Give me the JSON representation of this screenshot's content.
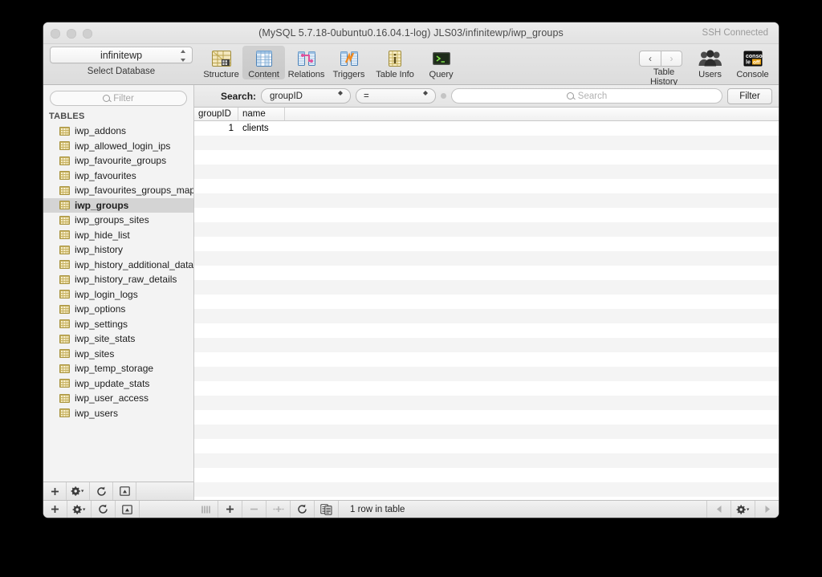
{
  "window": {
    "title": "(MySQL 5.7.18-0ubuntu0.16.04.1-log) JLS03/infinitewp/iwp_groups",
    "connection_status": "SSH Connected",
    "traffic_lights": [
      "close-button",
      "minimize-button",
      "zoom-button"
    ]
  },
  "toolbar": {
    "database_selected": "infinitewp",
    "database_label": "Select Database",
    "items": [
      {
        "label": "Structure",
        "icon": "structure-icon",
        "selected": false
      },
      {
        "label": "Content",
        "icon": "content-icon",
        "selected": true
      },
      {
        "label": "Relations",
        "icon": "relations-icon",
        "selected": false
      },
      {
        "label": "Triggers",
        "icon": "triggers-icon",
        "selected": false
      },
      {
        "label": "Table Info",
        "icon": "table-info-icon",
        "selected": false
      },
      {
        "label": "Query",
        "icon": "query-icon",
        "selected": false
      }
    ],
    "right_items": [
      {
        "label": "Table History",
        "icon": "history-nav-arrows"
      },
      {
        "label": "Users",
        "icon": "users-icon"
      },
      {
        "label": "Console",
        "icon": "console-icon"
      }
    ],
    "console_icon_text": {
      "line1": "conso",
      "line2": "le",
      "badge": "off"
    }
  },
  "sidebar": {
    "filter_placeholder": "Filter",
    "section_header": "TABLES",
    "tables": [
      {
        "name": "iwp_addons",
        "selected": false
      },
      {
        "name": "iwp_allowed_login_ips",
        "selected": false
      },
      {
        "name": "iwp_favourite_groups",
        "selected": false
      },
      {
        "name": "iwp_favourites",
        "selected": false
      },
      {
        "name": "iwp_favourites_groups_map",
        "selected": false
      },
      {
        "name": "iwp_groups",
        "selected": true
      },
      {
        "name": "iwp_groups_sites",
        "selected": false
      },
      {
        "name": "iwp_hide_list",
        "selected": false
      },
      {
        "name": "iwp_history",
        "selected": false
      },
      {
        "name": "iwp_history_additional_data",
        "selected": false
      },
      {
        "name": "iwp_history_raw_details",
        "selected": false
      },
      {
        "name": "iwp_login_logs",
        "selected": false
      },
      {
        "name": "iwp_options",
        "selected": false
      },
      {
        "name": "iwp_settings",
        "selected": false
      },
      {
        "name": "iwp_site_stats",
        "selected": false
      },
      {
        "name": "iwp_sites",
        "selected": false
      },
      {
        "name": "iwp_temp_storage",
        "selected": false
      },
      {
        "name": "iwp_update_stats",
        "selected": false
      },
      {
        "name": "iwp_user_access",
        "selected": false
      },
      {
        "name": "iwp_users",
        "selected": false
      }
    ],
    "footer_buttons": [
      {
        "name": "add-table-button",
        "glyph": "+"
      },
      {
        "name": "table-actions-menu-button",
        "glyph": "gear"
      },
      {
        "name": "refresh-tables-button",
        "glyph": "refresh"
      },
      {
        "name": "show-table-info-button",
        "glyph": "info-panel"
      }
    ]
  },
  "search": {
    "label": "Search:",
    "field_value": "groupID",
    "operator_value": "=",
    "input_value": "",
    "input_placeholder": "Search",
    "filter_button": "Filter"
  },
  "table": {
    "columns": [
      "groupID",
      "name"
    ],
    "rows": [
      {
        "groupID": "1",
        "name": "clients"
      }
    ],
    "empty_row_count": 25
  },
  "statusbar": {
    "row_count_text": "1 row in table",
    "left_buttons": [
      {
        "name": "add-row-button",
        "glyph": "+",
        "enabled": true
      },
      {
        "name": "remove-row-button",
        "glyph": "−",
        "enabled": false
      },
      {
        "name": "duplicate-row-button",
        "glyph": "duplicate",
        "enabled": false
      },
      {
        "name": "refresh-content-button",
        "glyph": "refresh",
        "enabled": true
      },
      {
        "name": "edit-in-sheet-button",
        "glyph": "sheet",
        "enabled": true
      }
    ],
    "right_buttons": [
      {
        "name": "previous-page-button",
        "glyph": "◀",
        "enabled": false
      },
      {
        "name": "pagination-settings-button",
        "glyph": "gear",
        "enabled": true
      },
      {
        "name": "next-page-button",
        "glyph": "▶",
        "enabled": false
      }
    ]
  },
  "colors": {
    "selection": "#d4d4d4",
    "row_stripe": "#f4f4f4",
    "table_icon": "#c9b465",
    "accent_blue": "#5b9bd5"
  }
}
